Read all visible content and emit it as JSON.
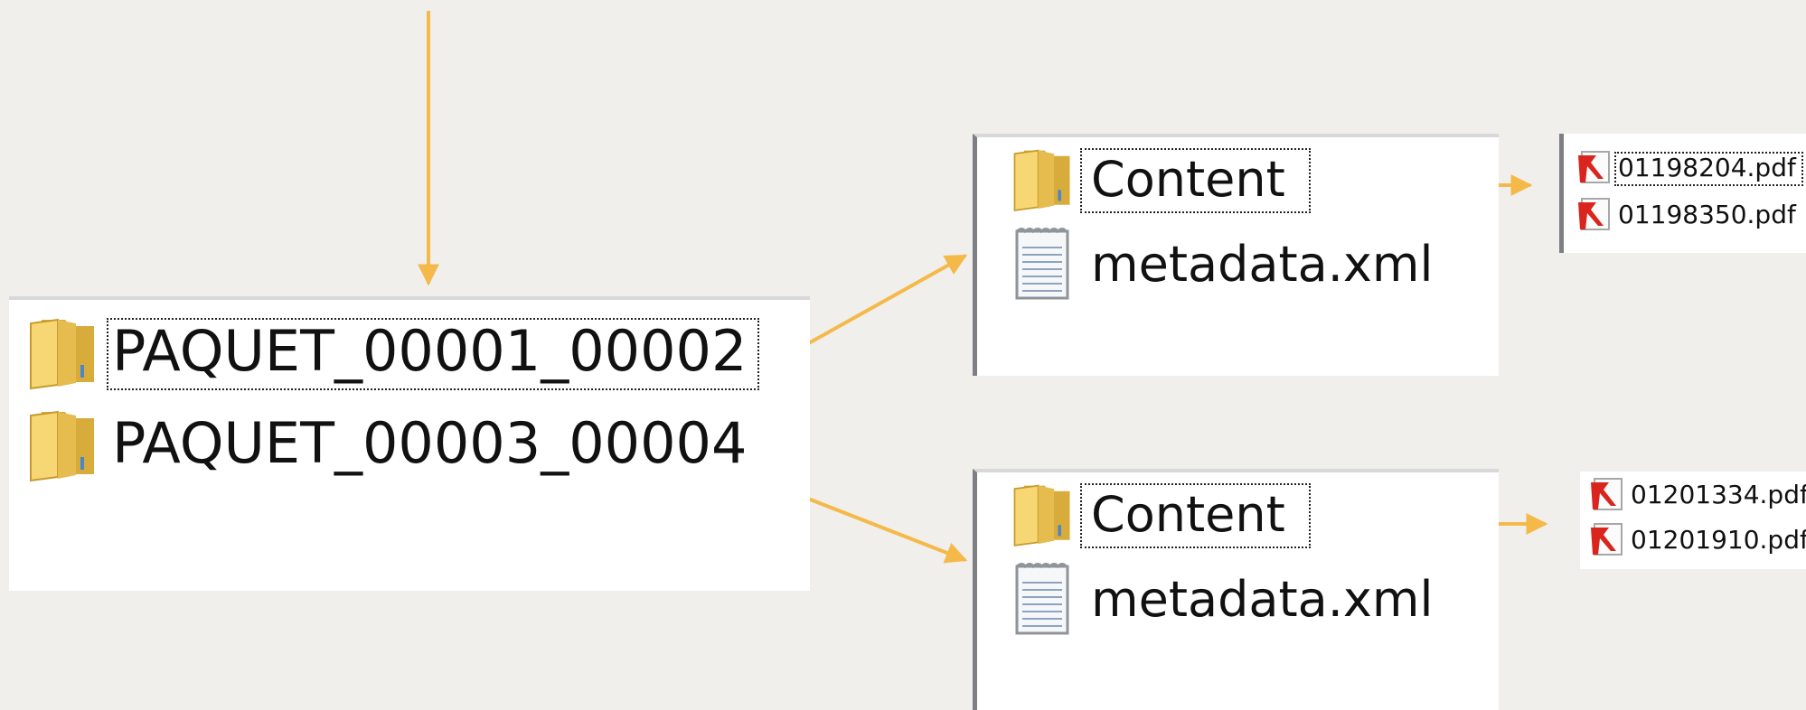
{
  "colors": {
    "background": "#f0efec",
    "pane": "#ffffff",
    "arrow": "#f5b94a",
    "folder": "#e8c14a",
    "pdf": "#d9251d"
  },
  "root_pane": {
    "items": [
      {
        "icon": "folder-icon",
        "label": "PAQUET_00001_00002",
        "focused": true
      },
      {
        "icon": "folder-icon",
        "label": "PAQUET_00003_00004",
        "focused": false
      }
    ]
  },
  "package_1_pane": {
    "items": [
      {
        "icon": "folder-icon",
        "label": "Content",
        "focused": true
      },
      {
        "icon": "text-file-icon",
        "label": "metadata.xml",
        "focused": false
      }
    ]
  },
  "package_2_pane": {
    "items": [
      {
        "icon": "folder-icon",
        "label": "Content",
        "focused": true
      },
      {
        "icon": "text-file-icon",
        "label": "metadata.xml",
        "focused": false
      }
    ]
  },
  "content_1_pane": {
    "items": [
      {
        "icon": "pdf-icon",
        "label": "01198204.pdf",
        "focused": true
      },
      {
        "icon": "pdf-icon",
        "label": "01198350.pdf",
        "focused": false
      }
    ]
  },
  "content_2_pane": {
    "items": [
      {
        "icon": "pdf-icon",
        "label": "01201334.pdf",
        "focused": false
      },
      {
        "icon": "pdf-icon",
        "label": "01201910.pdf",
        "focused": false
      }
    ]
  }
}
